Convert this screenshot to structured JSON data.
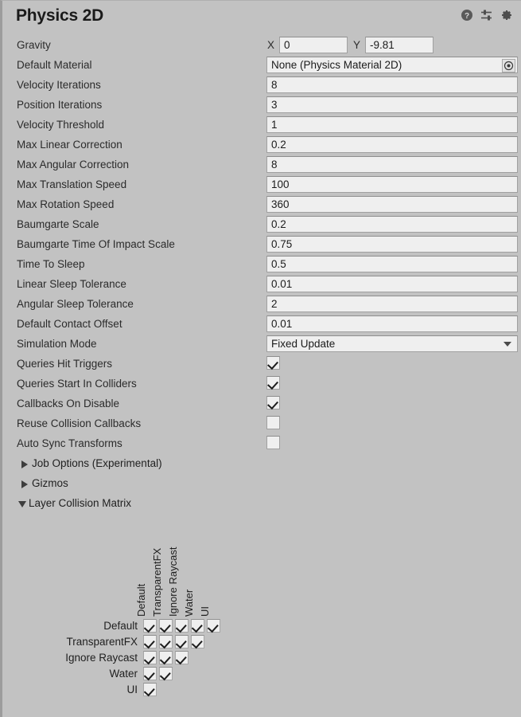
{
  "window": {
    "title": "Physics 2D",
    "icons": [
      {
        "name": "help-icon",
        "glyph": "?"
      },
      {
        "name": "preset-icon",
        "glyph": "sliders"
      },
      {
        "name": "settings-gear-icon",
        "glyph": "gear"
      }
    ]
  },
  "settings": {
    "gravity": {
      "label": "Gravity",
      "x_axis_label": "X",
      "y_axis_label": "Y",
      "x_value": "0",
      "y_value": "-9.81"
    },
    "default_material": {
      "label": "Default Material",
      "value": "None (Physics Material 2D)",
      "picker": "object-picker-icon"
    },
    "numeric_fields": [
      {
        "label": "Velocity Iterations",
        "value": "8"
      },
      {
        "label": "Position Iterations",
        "value": "3"
      },
      {
        "label": "Velocity Threshold",
        "value": "1"
      },
      {
        "label": "Max Linear Correction",
        "value": "0.2"
      },
      {
        "label": "Max Angular Correction",
        "value": "8"
      },
      {
        "label": "Max Translation Speed",
        "value": "100"
      },
      {
        "label": "Max Rotation Speed",
        "value": "360"
      },
      {
        "label": "Baumgarte Scale",
        "value": "0.2"
      },
      {
        "label": "Baumgarte Time Of Impact Scale",
        "value": "0.75"
      },
      {
        "label": "Time To Sleep",
        "value": "0.5"
      },
      {
        "label": "Linear Sleep Tolerance",
        "value": "0.01"
      },
      {
        "label": "Angular Sleep Tolerance",
        "value": "2"
      },
      {
        "label": "Default Contact Offset",
        "value": "0.01"
      }
    ],
    "simulation_mode": {
      "label": "Simulation Mode",
      "value": "Fixed Update"
    },
    "toggles": [
      {
        "label": "Queries Hit Triggers",
        "checked": true
      },
      {
        "label": "Queries Start In Colliders",
        "checked": true
      },
      {
        "label": "Callbacks On Disable",
        "checked": true
      },
      {
        "label": "Reuse Collision Callbacks",
        "checked": false
      },
      {
        "label": "Auto Sync Transforms",
        "checked": false
      }
    ],
    "foldouts": [
      {
        "label": "Job Options (Experimental)",
        "expanded": false
      },
      {
        "label": "Gizmos",
        "expanded": false
      },
      {
        "label": "Layer Collision Matrix",
        "expanded": true
      }
    ]
  },
  "layer_collision_matrix": {
    "column_labels": [
      "Default",
      "TransparentFX",
      "Ignore Raycast",
      "Water",
      "UI"
    ],
    "row_labels": [
      "Default",
      "TransparentFX",
      "Ignore Raycast",
      "Water",
      "UI"
    ],
    "cells": [
      [
        true,
        true,
        true,
        true,
        true
      ],
      [
        true,
        true,
        true,
        true
      ],
      [
        true,
        true,
        true
      ],
      [
        true,
        true
      ],
      [
        true
      ]
    ]
  },
  "colors": {
    "background": "#c2c2c2",
    "field_background": "#efefef",
    "field_border": "#a0a0a0",
    "text": "#1f1f1f",
    "title": "#1a1a1a"
  }
}
